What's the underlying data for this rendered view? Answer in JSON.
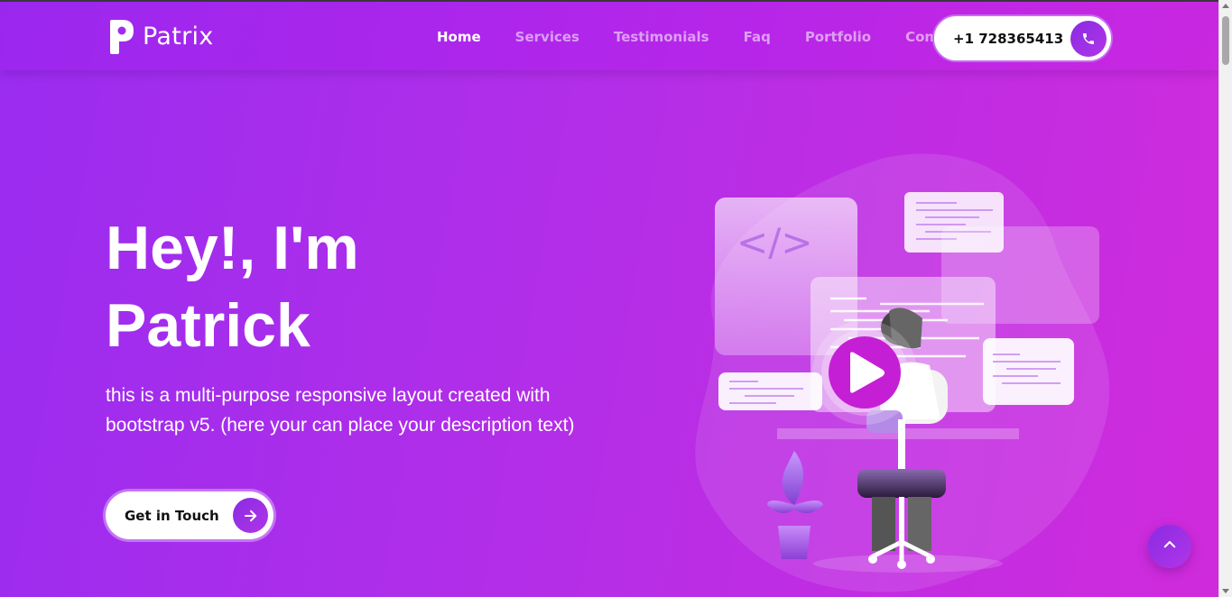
{
  "brand": {
    "name": "Patrix",
    "logo_icon": "p-logo-icon"
  },
  "nav": {
    "links": [
      {
        "label": "Home",
        "active": true
      },
      {
        "label": "Services",
        "active": false
      },
      {
        "label": "Testimonials",
        "active": false
      },
      {
        "label": "Faq",
        "active": false
      },
      {
        "label": "Portfolio",
        "active": false
      },
      {
        "label": "Contact",
        "active": false
      }
    ],
    "phone": {
      "number": "+1 728365413",
      "icon": "phone-icon"
    }
  },
  "hero": {
    "title_line1": "Hey!, I'm",
    "title_line2": "Patrick",
    "description": "this is a multi-purpose responsive layout created with bootstrap v5. (here your can place your description text)",
    "cta_label": "Get in Touch",
    "cta_icon": "arrow-right-icon",
    "illustration": {
      "code_symbol": "</>",
      "play_icon": "play-icon"
    }
  },
  "scroll_top": {
    "icon": "chevron-up-icon"
  },
  "colors": {
    "accent": "#8a2be2",
    "gradient_start": "#9a2cf0",
    "gradient_end": "#d02bdc",
    "play_button": "#c51fd6"
  }
}
